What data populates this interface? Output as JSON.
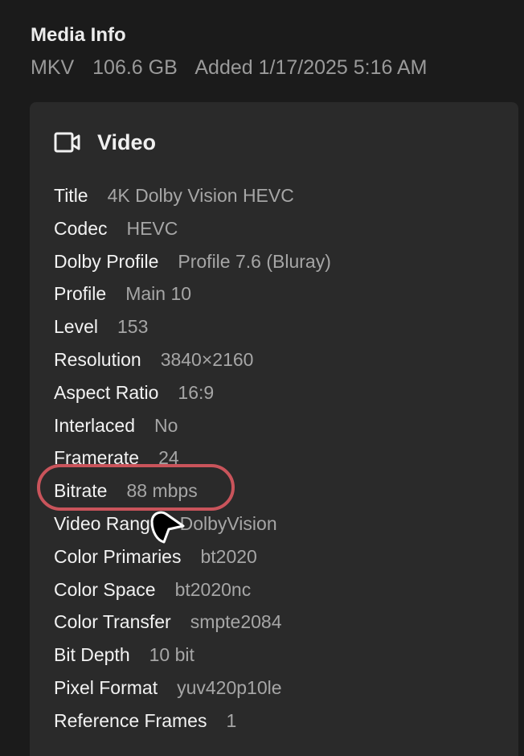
{
  "media_info": {
    "heading": "Media Info",
    "container": "MKV",
    "size": "106.6 GB",
    "added": "Added 1/17/2025 5:16 AM"
  },
  "video": {
    "heading": "Video",
    "icon": "video-camera-icon",
    "properties": [
      {
        "label": "Title",
        "value": "4K Dolby Vision HEVC"
      },
      {
        "label": "Codec",
        "value": "HEVC"
      },
      {
        "label": "Dolby Profile",
        "value": "Profile 7.6 (Bluray)"
      },
      {
        "label": "Profile",
        "value": "Main 10"
      },
      {
        "label": "Level",
        "value": "153"
      },
      {
        "label": "Resolution",
        "value": "3840×2160"
      },
      {
        "label": "Aspect Ratio",
        "value": "16:9"
      },
      {
        "label": "Interlaced",
        "value": "No"
      },
      {
        "label": "Framerate",
        "value": "24"
      },
      {
        "label": "Bitrate",
        "value": "88 mbps"
      },
      {
        "label": "Video Range",
        "value": "DolbyVision"
      },
      {
        "label": "Color Primaries",
        "value": "bt2020"
      },
      {
        "label": "Color Space",
        "value": "bt2020nc"
      },
      {
        "label": "Color Transfer",
        "value": "smpte2084"
      },
      {
        "label": "Bit Depth",
        "value": "10 bit"
      },
      {
        "label": "Pixel Format",
        "value": "yuv420p10le"
      },
      {
        "label": "Reference Frames",
        "value": "1"
      }
    ]
  },
  "colors": {
    "background": "#1b1b1b",
    "card": "#2a2a2a",
    "highlight_ring": "#c9545b"
  }
}
